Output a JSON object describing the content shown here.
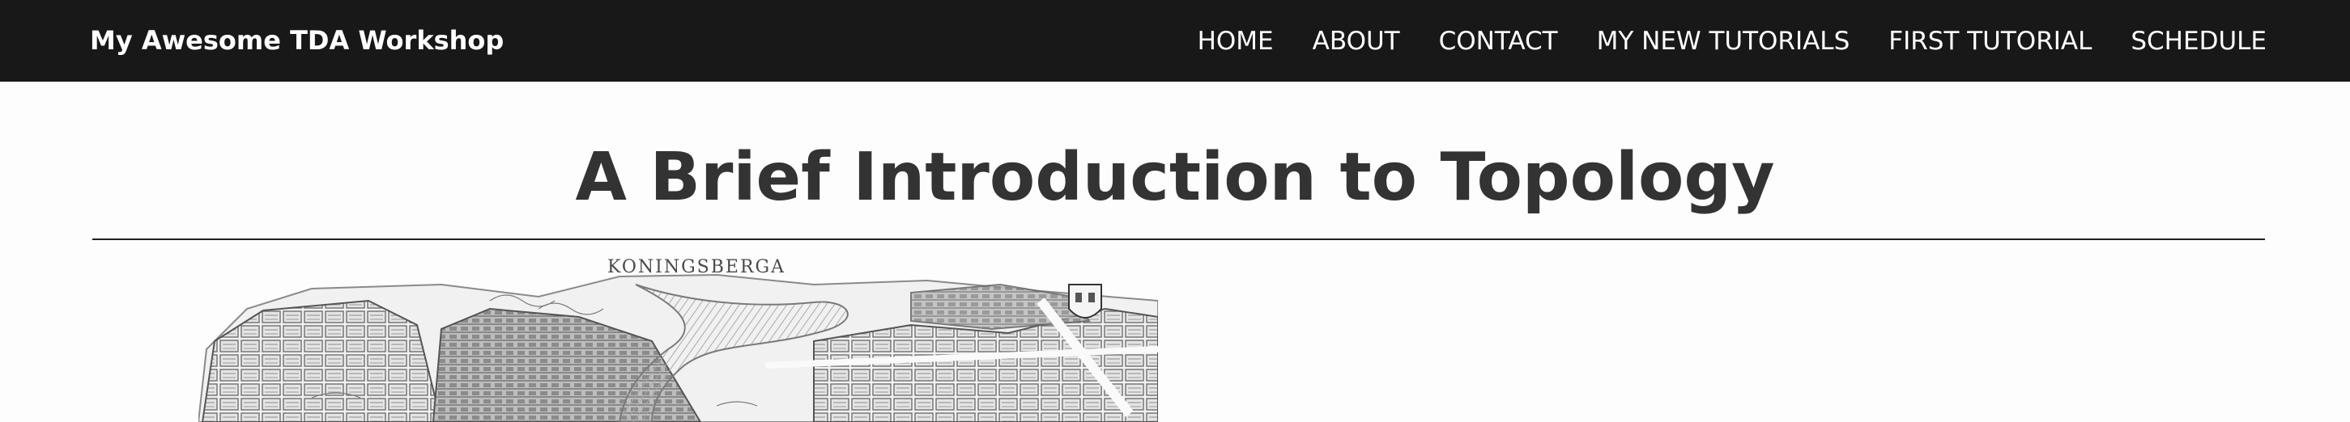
{
  "header": {
    "brand": "My Awesome TDA Workshop",
    "nav": [
      {
        "label": "HOME"
      },
      {
        "label": "ABOUT"
      },
      {
        "label": "CONTACT"
      },
      {
        "label": "MY NEW TUTORIALS"
      },
      {
        "label": "FIRST TUTORIAL"
      },
      {
        "label": "SCHEDULE"
      }
    ]
  },
  "main": {
    "title": "A Brief Introduction to Topology",
    "figure": {
      "caption": "KONINGSBERGA"
    }
  },
  "colors": {
    "header_bg": "#181818",
    "header_text": "#ffffff",
    "title_text": "#333333",
    "page_bg": "#fdfdfd"
  }
}
